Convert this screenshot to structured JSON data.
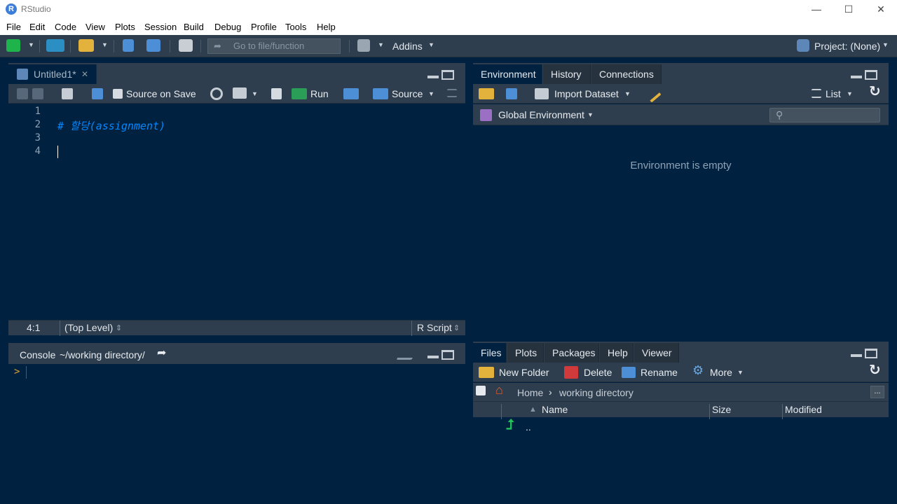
{
  "window": {
    "title": "RStudio",
    "app_icon": "R",
    "controls": {
      "minimize": "—",
      "maximize": "☐",
      "close": "✕"
    }
  },
  "menu": [
    "File",
    "Edit",
    "Code",
    "View",
    "Plots",
    "Session",
    "Build",
    "Debug",
    "Profile",
    "Tools",
    "Help"
  ],
  "toolbar": {
    "goto_placeholder": "Go to file/function",
    "addins_label": "Addins",
    "project_label": "Project: (None)"
  },
  "editor": {
    "tab_label": "Untitled1*",
    "tab_close": "✕",
    "source_on_save_label": "Source on Save",
    "run_label": "Run",
    "source_label": "Source",
    "lines": [
      "1",
      "2",
      "3",
      "4"
    ],
    "code_line2": "# 할당(assignment)",
    "status": {
      "position": "4:1",
      "scope": "(Top Level)",
      "file_type": "R Script"
    }
  },
  "console": {
    "title": "Console",
    "path": "~/working directory/",
    "prompt": ">"
  },
  "environment": {
    "tabs": [
      "Environment",
      "History",
      "Connections"
    ],
    "import_label": "Import Dataset",
    "list_label": "List",
    "scope_label": "Global Environment",
    "empty_message": "Environment is empty"
  },
  "files": {
    "tabs": [
      "Files",
      "Plots",
      "Packages",
      "Help",
      "Viewer"
    ],
    "new_folder_label": "New Folder",
    "delete_label": "Delete",
    "rename_label": "Rename",
    "more_label": "More",
    "breadcrumb_home": "Home",
    "breadcrumb_sep": "›",
    "breadcrumb_dir": "working directory",
    "overflow": "...",
    "columns": {
      "name": "Name",
      "size": "Size",
      "modified": "Modified"
    },
    "sort_indicator": "▲",
    "rows": [
      {
        "name": ".."
      }
    ]
  },
  "colors": {
    "background": "#002240",
    "chrome": "#2e3e4f",
    "comment": "#0088ff",
    "green_accent": "#21c45a"
  }
}
